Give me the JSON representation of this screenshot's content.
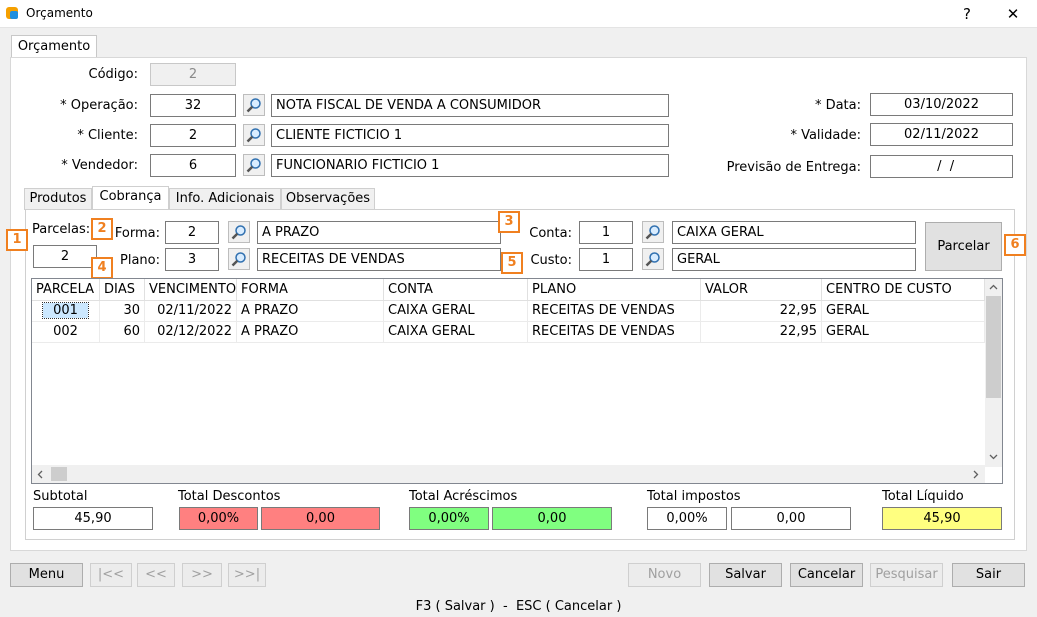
{
  "window": {
    "title": "Orçamento",
    "help": "?",
    "close": "✕"
  },
  "main_tab": "Orçamento",
  "header": {
    "codigo": {
      "label": "Código:",
      "value": "2"
    },
    "operacao": {
      "label": "* Operação:",
      "code": "32",
      "desc": "NOTA FISCAL DE VENDA A CONSUMIDOR"
    },
    "cliente": {
      "label": "* Cliente:",
      "code": "2",
      "desc": "CLIENTE FICTICIO 1"
    },
    "vendedor": {
      "label": "* Vendedor:",
      "code": "6",
      "desc": "FUNCIONARIO FICTICIO 1"
    },
    "data": {
      "label": "* Data:",
      "value": "03/10/2022"
    },
    "validade": {
      "label": "* Validade:",
      "value": "02/11/2022"
    },
    "previsao": {
      "label": "Previsão de Entrega:",
      "value": "  /  /"
    }
  },
  "tabs": [
    "Produtos",
    "Cobrança",
    "Info. Adicionais",
    "Observações"
  ],
  "cobranca": {
    "parcelas": {
      "label": "Parcelas:",
      "value": "2"
    },
    "forma": {
      "label": "Forma:",
      "code": "2",
      "desc": "A PRAZO"
    },
    "plano": {
      "label": "Plano:",
      "code": "3",
      "desc": "RECEITAS DE VENDAS"
    },
    "conta": {
      "label": "Conta:",
      "code": "1",
      "desc": "CAIXA GERAL"
    },
    "custo": {
      "label": "Custo:",
      "code": "1",
      "desc": "GERAL"
    },
    "parcelar": "Parcelar"
  },
  "badges": [
    "1",
    "2",
    "3",
    "4",
    "5",
    "6"
  ],
  "grid": {
    "columns": [
      "PARCELA",
      "DIAS",
      "VENCIMENTO",
      "FORMA",
      "CONTA",
      "PLANO",
      "VALOR",
      "CENTRO DE CUSTO"
    ],
    "rows": [
      [
        "001",
        "30",
        "02/11/2022",
        "A PRAZO",
        "CAIXA GERAL",
        "RECEITAS DE VENDAS",
        "22,95",
        "GERAL"
      ],
      [
        "002",
        "60",
        "02/12/2022",
        "A PRAZO",
        "CAIXA GERAL",
        "RECEITAS DE VENDAS",
        "22,95",
        "GERAL"
      ]
    ]
  },
  "totals": {
    "subtotal": {
      "label": "Subtotal",
      "value": "45,90"
    },
    "descontos": {
      "label": "Total Descontos",
      "pct": "0,00%",
      "value": "0,00"
    },
    "acrescimos": {
      "label": "Total Acréscimos",
      "pct": "0,00%",
      "value": "0,00"
    },
    "impostos": {
      "label": "Total impostos",
      "pct": "0,00%",
      "value": "0,00"
    },
    "liquido": {
      "label": "Total Líquido",
      "value": "45,90"
    }
  },
  "toolbar": {
    "menu": "Menu",
    "first": "|<<",
    "prev": "<<",
    "next": ">>",
    "last": ">>|",
    "novo": "Novo",
    "salvar": "Salvar",
    "cancelar": "Cancelar",
    "pesquisar": "Pesquisar",
    "sair": "Sair"
  },
  "status": "F3 ( Salvar )  -  ESC ( Cancelar )",
  "colors": {
    "accent": "#f08020",
    "red": "#ff8080",
    "green": "#80ff80",
    "yellow": "#ffff80",
    "selected": "#cce8ff"
  }
}
